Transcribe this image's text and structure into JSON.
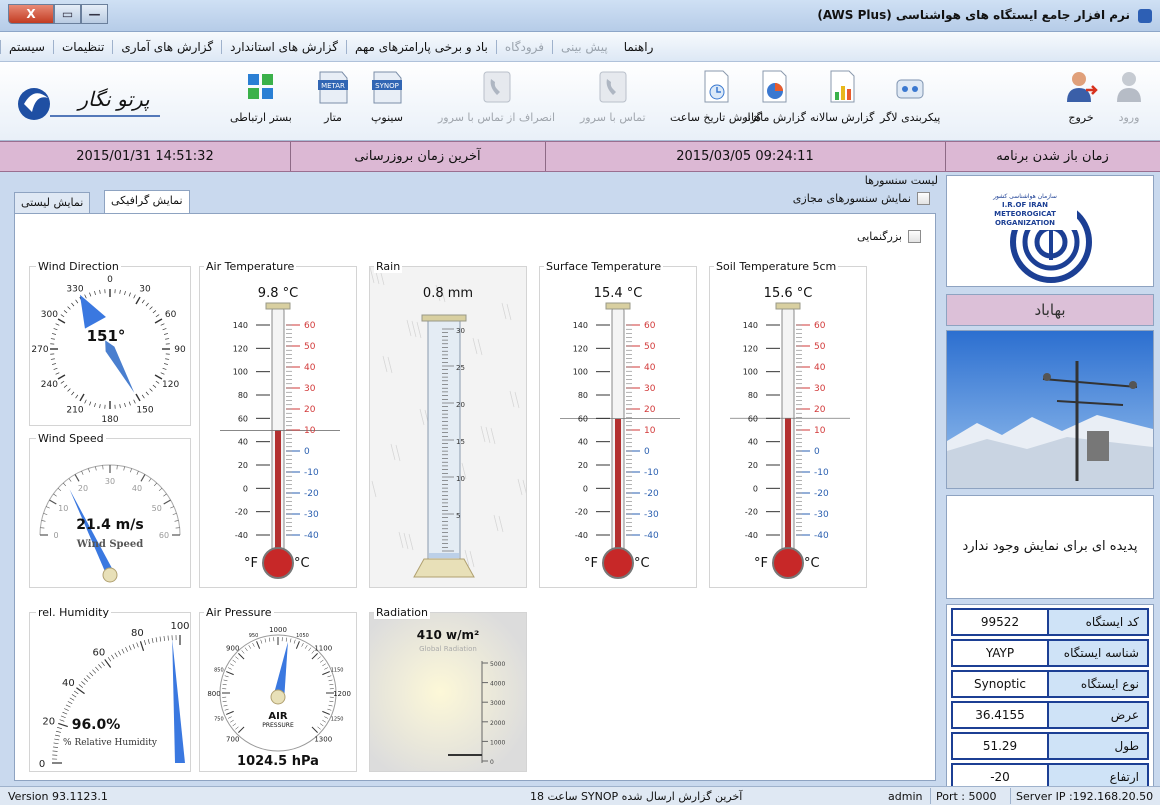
{
  "window": {
    "title": "نرم افزار جامع ایستگاه های هواشناسی (AWS Plus)",
    "close_glyph": "X",
    "max_glyph": "▭",
    "min_glyph": "—"
  },
  "menu": [
    "سیستم",
    "تنظیمات",
    "گزارش های آماری",
    "گزارش های استاندارد",
    "باد و برخی پارامترهای مهم",
    "فرودگاه",
    "پیش بینی",
    "راهنما"
  ],
  "toolbar": {
    "login": "ورود",
    "exit": "خروج",
    "logger_config": "پیکربندی لاگر",
    "yearly_report": "گزارش سالانه",
    "monthly_report": "گزارش ماهانه",
    "hourly_report": "گزارش تاریخ ساعت",
    "contact_server": "تماس با سرور",
    "disconnect_server": "انصراف از تماس با سرور",
    "synop": "سینوپ",
    "synop_badge": "SYNOP",
    "metar": "متار",
    "metar_badge": "METAR",
    "comm": "بستر ارتباطی",
    "logo_text": "پرتو نگار"
  },
  "timestrip": {
    "open_label": "زمان باز شدن برنامه",
    "open_value": "2015/03/05 09:24:11",
    "update_label": "آخرین زمان بروزرسانی",
    "update_value": "2015/01/31 14:51:32"
  },
  "sensors": {
    "list_title": "لیست سنسورها",
    "virtual_label": "نمایش سنسورهای مجازی",
    "zoom_label": "بزرگنمایی"
  },
  "tabs": {
    "graphic": "نمایش گرافیکی",
    "list": "نمایش لیستی"
  },
  "gauges": {
    "wind_direction": {
      "title": "Wind Direction",
      "value": "151°",
      "ticks": [
        "0",
        "30",
        "60",
        "90",
        "120",
        "150",
        "180",
        "210",
        "240",
        "270",
        "300",
        "330"
      ],
      "angle": 151
    },
    "wind_speed": {
      "title": "Wind Speed",
      "value": "21.4 m/s",
      "caption": "Wind Speed",
      "ticks": [
        "0",
        "10",
        "20",
        "30",
        "40",
        "50",
        "60"
      ],
      "speed": 21.4,
      "max": 60
    },
    "air_temp": {
      "title": "Air Temperature",
      "value": "9.8 °C",
      "reading": 9.8
    },
    "rain": {
      "title": "Rain",
      "value": "0.8 mm",
      "ticks": [
        "30",
        "25",
        "20",
        "15",
        "10",
        "5"
      ]
    },
    "surface_temp": {
      "title": "Surface Temperature",
      "value": "15.4 °C",
      "reading": 15.4
    },
    "soil_temp": {
      "title": "Soil Temperature 5cm",
      "value": "15.6 °C",
      "reading": 15.6
    },
    "humidity": {
      "title": "rel. Humidity",
      "value": "96.0%",
      "caption": "% Relative Humidity",
      "ticks": [
        "0",
        "20",
        "40",
        "60",
        "80",
        "100"
      ],
      "reading": 96.0
    },
    "pressure": {
      "title": "Air Pressure",
      "value": "1024.5 hPa",
      "caption1": "AIR",
      "caption2": "PRESSURE",
      "ticks": [
        "700",
        "750",
        "800",
        "850",
        "900",
        "950",
        "1000",
        "1050",
        "1100",
        "1150",
        "1200",
        "1250",
        "1300"
      ],
      "reading": 1024.5
    },
    "radiation": {
      "title": "Radiation",
      "value": "410 w/m²",
      "caption": "Global Radiation",
      "ticks": [
        "5000",
        "4000",
        "3000",
        "2000",
        "1000",
        "0"
      ]
    }
  },
  "thermo": {
    "f_ticks": [
      "140",
      "120",
      "100",
      "80",
      "60",
      "40",
      "20",
      "0",
      "-20",
      "-40"
    ],
    "c_ticks": [
      "60",
      "50",
      "40",
      "30",
      "20",
      "10",
      "0",
      "-10",
      "-20",
      "-30",
      "-40"
    ],
    "f_label": "°F",
    "c_label": "°C"
  },
  "right_panel": {
    "org_line1": "سازمان هواشناسی کشور",
    "org_line2": "I.R.OF IRAN",
    "org_line3": "METEOROGICAT",
    "org_line4": "ORGANIZATION",
    "station_name": "بهاباد",
    "phenomenon": "پدیده ای برای نمایش وجود ندارد"
  },
  "station_info": [
    {
      "label": "کد ایستگاه",
      "value": "99522"
    },
    {
      "label": "شناسه ایستگاه",
      "value": "YAYP"
    },
    {
      "label": "نوع ایستگاه",
      "value": "Synoptic"
    },
    {
      "label": "عرض",
      "value": "36.4155"
    },
    {
      "label": "طول",
      "value": "51.29"
    },
    {
      "label": "ارتفاع",
      "value": "-20"
    }
  ],
  "status": {
    "version": "Version 93.1123.1",
    "last_synop": "آخرین گزارش ارسال شده SYNOP ساعت 18",
    "user": "admin",
    "port": "Port : 5000",
    "server": "Server IP :192.168.20.50"
  },
  "colors": {
    "accent": "#1c3f94",
    "timestrip": "#dcb8d4",
    "needle": "#3a78e0",
    "celsius": "#d23a3a",
    "mercury": "#b33030"
  }
}
